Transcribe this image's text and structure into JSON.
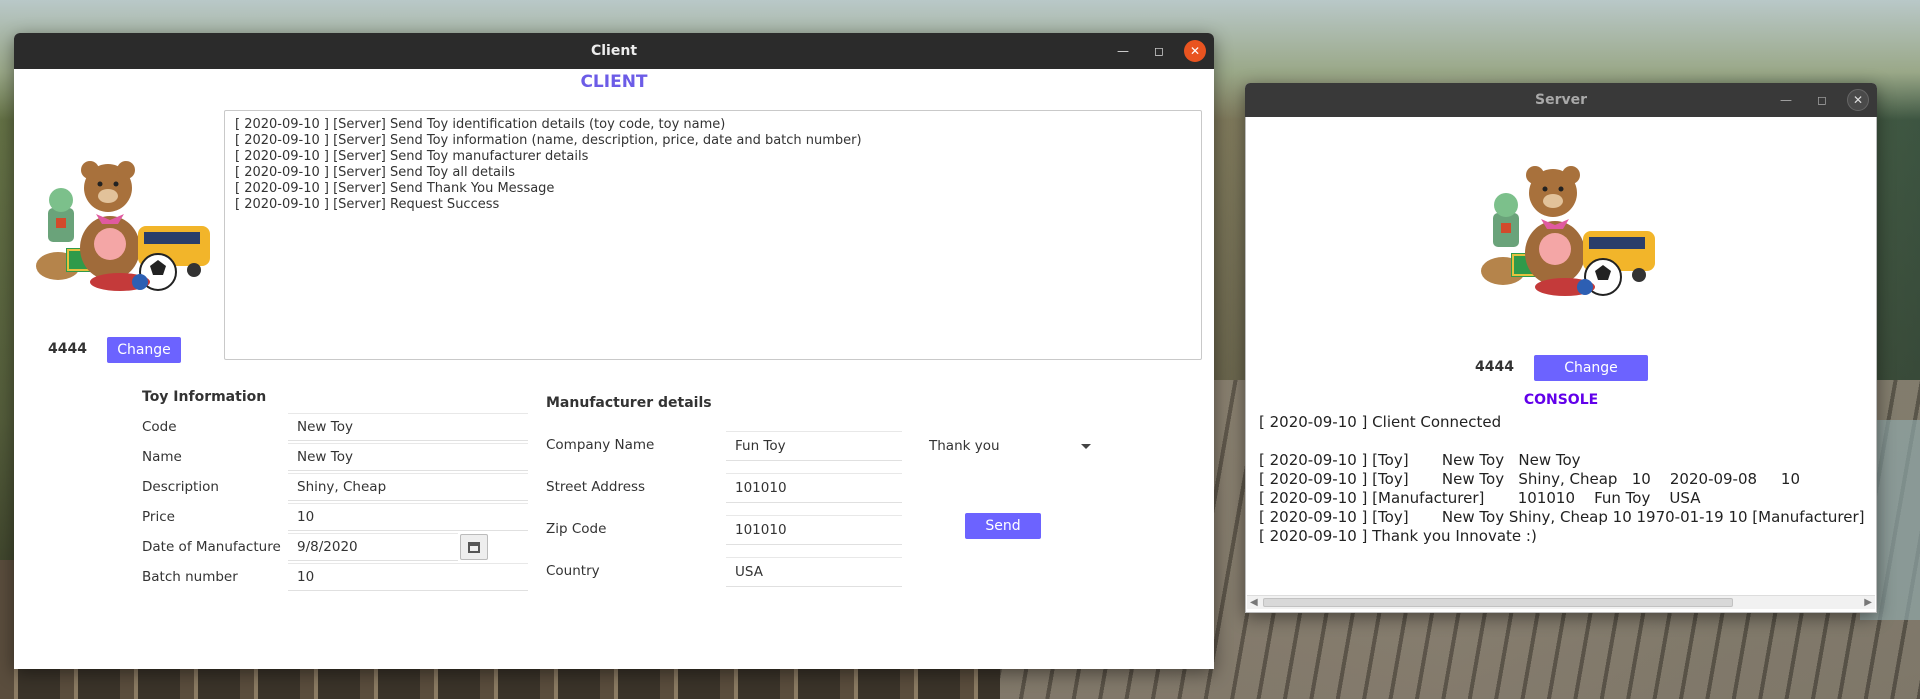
{
  "client": {
    "window_title": "Client",
    "heading": "CLIENT",
    "port": "4444",
    "change_label": "Change",
    "log": [
      "[ 2020-09-10 ] [Server]  Send Toy identification details (toy code, toy name)",
      "[ 2020-09-10 ] [Server]  Send Toy information (name, description, price, date and batch number)",
      "[ 2020-09-10 ] [Server]  Send Toy manufacturer details",
      "[ 2020-09-10 ] [Server]  Send Toy all details",
      "[ 2020-09-10 ] [Server]  Send Thank You Message",
      "[ 2020-09-10 ] [Server]  Request Success"
    ],
    "toy_info": {
      "title": "Toy Information",
      "code_label": "Code",
      "code_value": "New Toy",
      "name_label": "Name",
      "name_value": "New Toy",
      "description_label": "Description",
      "description_value": "Shiny, Cheap",
      "price_label": "Price",
      "price_value": "10",
      "date_label": "Date of Manufacture",
      "date_value": "9/8/2020",
      "batch_label": "Batch number",
      "batch_value": "10"
    },
    "manufacturer": {
      "title": "Manufacturer details",
      "company_label": "Company Name",
      "company_value": "Fun Toy",
      "street_label": "Street Address",
      "street_value": "101010",
      "zip_label": "Zip Code",
      "zip_value": "101010",
      "country_label": "Country",
      "country_value": "USA"
    },
    "message_select": "Thank you",
    "send_label": "Send"
  },
  "server": {
    "window_title": "Server",
    "port": "4444",
    "change_label": "Change",
    "console_heading": "CONSOLE",
    "console_lines": [
      "[ 2020-09-10 ] Client Connected",
      "",
      "[ 2020-09-10 ] [Toy]       New Toy   New Toy",
      "[ 2020-09-10 ] [Toy]       New Toy   Shiny, Cheap   10    2020-09-08     10",
      "[ 2020-09-10 ] [Manufacturer]       101010    Fun Toy    USA",
      "[ 2020-09-10 ] [Toy]       New Toy Shiny, Cheap 10 1970-01-19 10 [Manufacturer]",
      "[ 2020-09-10 ] Thank you Innovate :)"
    ]
  },
  "colors": {
    "accent": "#6c63ff",
    "heading_purple": "#6c5ce7",
    "console_heading": "#6200ea",
    "close_orange": "#e95420"
  },
  "icons": [
    "minimize-icon",
    "maximize-icon",
    "close-icon",
    "calendar-icon",
    "chevron-down-icon",
    "toys-illustration"
  ]
}
